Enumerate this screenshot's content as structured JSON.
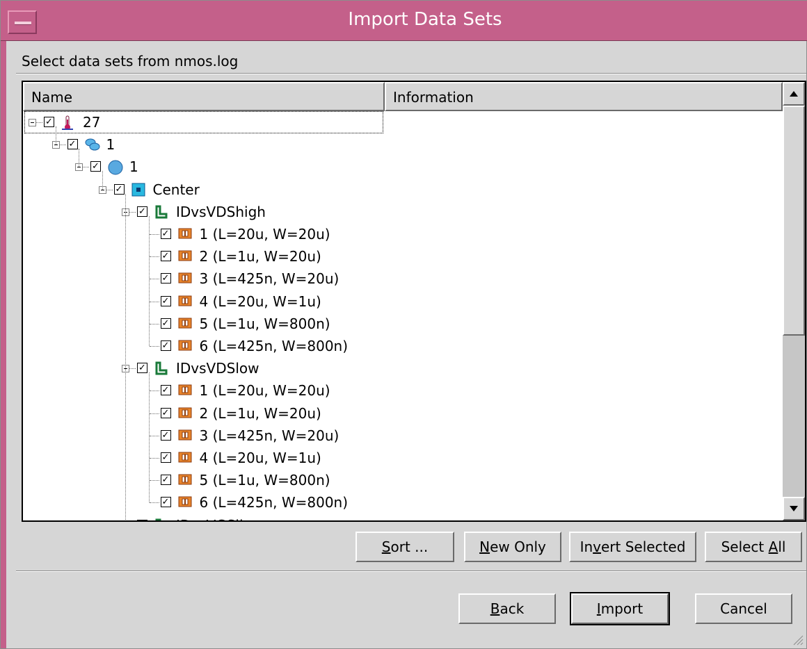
{
  "window": {
    "title": "Import Data Sets"
  },
  "caption": "Select data sets from nmos.log",
  "columns": {
    "name": "Name",
    "information": "Information"
  },
  "tree": [
    {
      "label": "27",
      "icon": "thermometer-icon",
      "level": 0,
      "expanded": true,
      "checked": true
    },
    {
      "label": "1",
      "icon": "wafer-stack-icon",
      "level": 1,
      "expanded": true,
      "checked": true
    },
    {
      "label": "1",
      "icon": "wafer-icon",
      "level": 2,
      "expanded": true,
      "checked": true
    },
    {
      "label": "Center",
      "icon": "die-site-icon",
      "level": 3,
      "expanded": true,
      "checked": true
    },
    {
      "label": "IDvsVDShigh",
      "icon": "setup-icon",
      "level": 4,
      "expanded": true,
      "checked": true
    },
    {
      "label": "1 (L=20u, W=20u)",
      "icon": "device-icon",
      "level": 5,
      "checked": true
    },
    {
      "label": "2 (L=1u, W=20u)",
      "icon": "device-icon",
      "level": 5,
      "checked": true
    },
    {
      "label": "3 (L=425n, W=20u)",
      "icon": "device-icon",
      "level": 5,
      "checked": true
    },
    {
      "label": "4 (L=20u, W=1u)",
      "icon": "device-icon",
      "level": 5,
      "checked": true
    },
    {
      "label": "5 (L=1u, W=800n)",
      "icon": "device-icon",
      "level": 5,
      "checked": true
    },
    {
      "label": "6 (L=425n, W=800n)",
      "icon": "device-icon",
      "level": 5,
      "checked": true
    },
    {
      "label": "IDvsVDSlow",
      "icon": "setup-icon",
      "level": 4,
      "expanded": true,
      "checked": true
    },
    {
      "label": "1 (L=20u, W=20u)",
      "icon": "device-icon",
      "level": 5,
      "checked": true
    },
    {
      "label": "2 (L=1u, W=20u)",
      "icon": "device-icon",
      "level": 5,
      "checked": true
    },
    {
      "label": "3 (L=425n, W=20u)",
      "icon": "device-icon",
      "level": 5,
      "checked": true
    },
    {
      "label": "4 (L=20u, W=1u)",
      "icon": "device-icon",
      "level": 5,
      "checked": true
    },
    {
      "label": "5 (L=1u, W=800n)",
      "icon": "device-icon",
      "level": 5,
      "checked": true
    },
    {
      "label": "6 (L=425n, W=800n)",
      "icon": "device-icon",
      "level": 5,
      "checked": true
    },
    {
      "label": "IDvsVGSlin",
      "icon": "setup-icon",
      "level": 4,
      "expanded": true,
      "checked": true
    }
  ],
  "list_buttons": {
    "sort": {
      "mnemonic": "S",
      "rest": "ort ..."
    },
    "new_only": {
      "mnemonic": "N",
      "rest": "ew Only"
    },
    "invert": {
      "pre": "In",
      "mnemonic": "v",
      "rest": "ert Selected"
    },
    "select_all": {
      "pre": "Select ",
      "mnemonic": "A",
      "rest": "ll"
    }
  },
  "dialog_buttons": {
    "back": {
      "mnemonic": "B",
      "rest": "ack"
    },
    "import": {
      "mnemonic": "I",
      "rest": "mport"
    },
    "cancel": "Cancel"
  },
  "colors": {
    "titlebar": "#c4608a",
    "dialog_bg": "#d6d6d6"
  }
}
